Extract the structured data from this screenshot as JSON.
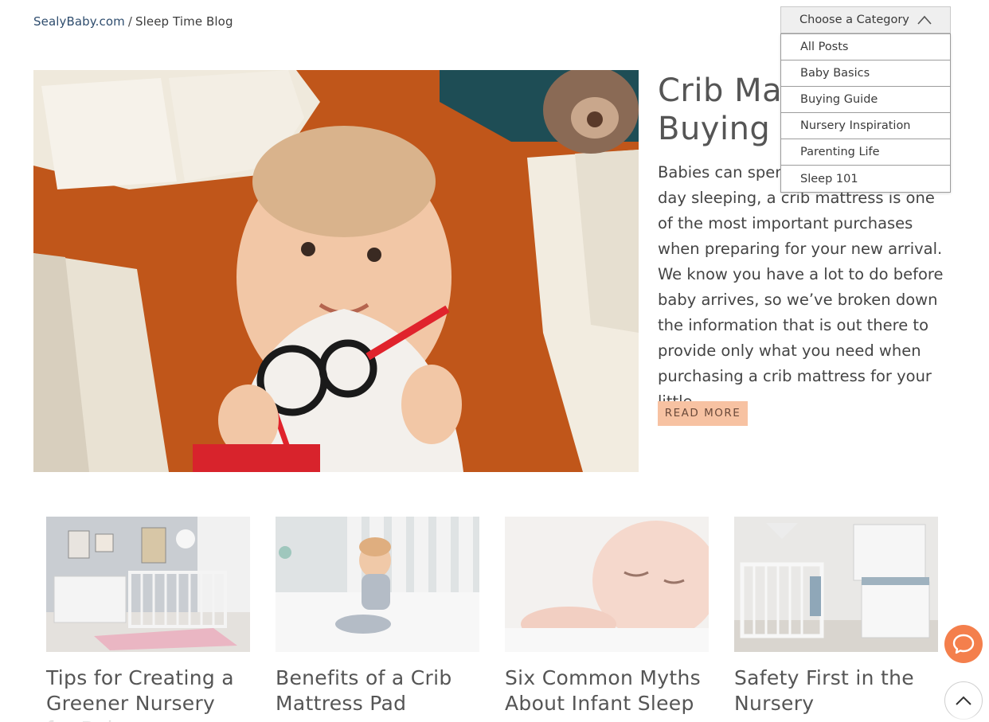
{
  "breadcrumb": {
    "home": "SealyBaby.com",
    "separator": "/",
    "current": "Sleep Time Blog"
  },
  "featured": {
    "title_line1": "Crib Mattress",
    "title_line2": "Buying Guide",
    "excerpt": "Babies can spend up to 16 hours a day sleeping, a crib mattress is one of the most important purchases when preparing for your new arrival. We know you have a lot to do before baby arrives, so we’ve broken down the information that is out there to provide only what you need when purchasing a crib mattress for your little…",
    "read_more": "READ MORE",
    "image_icon": "baby-with-glasses-photo"
  },
  "category_dropdown": {
    "label": "Choose a Category",
    "expanded": true,
    "options": [
      "All Posts",
      "Baby Basics",
      "Buying Guide",
      "Nursery Inspiration",
      "Parenting Life",
      "Sleep 101"
    ]
  },
  "cards": [
    {
      "title": "Tips for Creating a Greener Nursery for Baby",
      "image_icon": "nursery-photo"
    },
    {
      "title": "Benefits of a Crib Mattress Pad",
      "image_icon": "baby-in-crib-photo"
    },
    {
      "title": "Six Common Myths About Infant Sleep",
      "image_icon": "sleeping-baby-photo"
    },
    {
      "title": "Safety First in the Nursery",
      "image_icon": "white-nursery-photo"
    }
  ],
  "floating": {
    "chat_icon": "chat-bubble-icon",
    "top_icon": "chevron-up-icon"
  },
  "colors": {
    "accent": "#f7c2a2",
    "chat": "#f47f4c",
    "link": "#2f4d6e"
  }
}
